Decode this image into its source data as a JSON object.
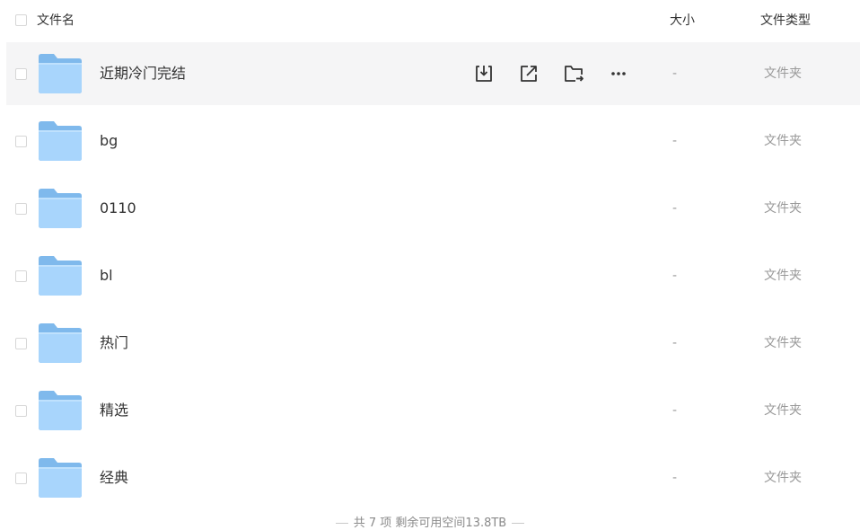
{
  "header": {
    "name_label": "文件名",
    "size_label": "大小",
    "type_label": "文件类型"
  },
  "files": [
    {
      "name": "近期冷门完结",
      "size": "-",
      "type": "文件夹",
      "icon": "folder-icon"
    },
    {
      "name": "bg",
      "size": "-",
      "type": "文件夹",
      "icon": "folder-icon"
    },
    {
      "name": "0110",
      "size": "-",
      "type": "文件夹",
      "icon": "folder-icon"
    },
    {
      "name": "bl",
      "size": "-",
      "type": "文件夹",
      "icon": "folder-icon"
    },
    {
      "name": "热门",
      "size": "-",
      "type": "文件夹",
      "icon": "folder-icon"
    },
    {
      "name": "精选",
      "size": "-",
      "type": "文件夹",
      "icon": "folder-icon"
    },
    {
      "name": "经典",
      "size": "-",
      "type": "文件夹",
      "icon": "folder-icon"
    }
  ],
  "row_actions": [
    {
      "icon": "download-icon"
    },
    {
      "icon": "share-icon"
    },
    {
      "icon": "move-icon"
    },
    {
      "icon": "more-icon"
    }
  ],
  "footer": {
    "summary": "共 7 项 剩余可用空间13.8TB"
  },
  "colors": {
    "hover_row": "#f5f5f6",
    "folder_body": "#a5d4fb",
    "folder_tab": "#7fb9ec",
    "muted_text": "#999999"
  }
}
